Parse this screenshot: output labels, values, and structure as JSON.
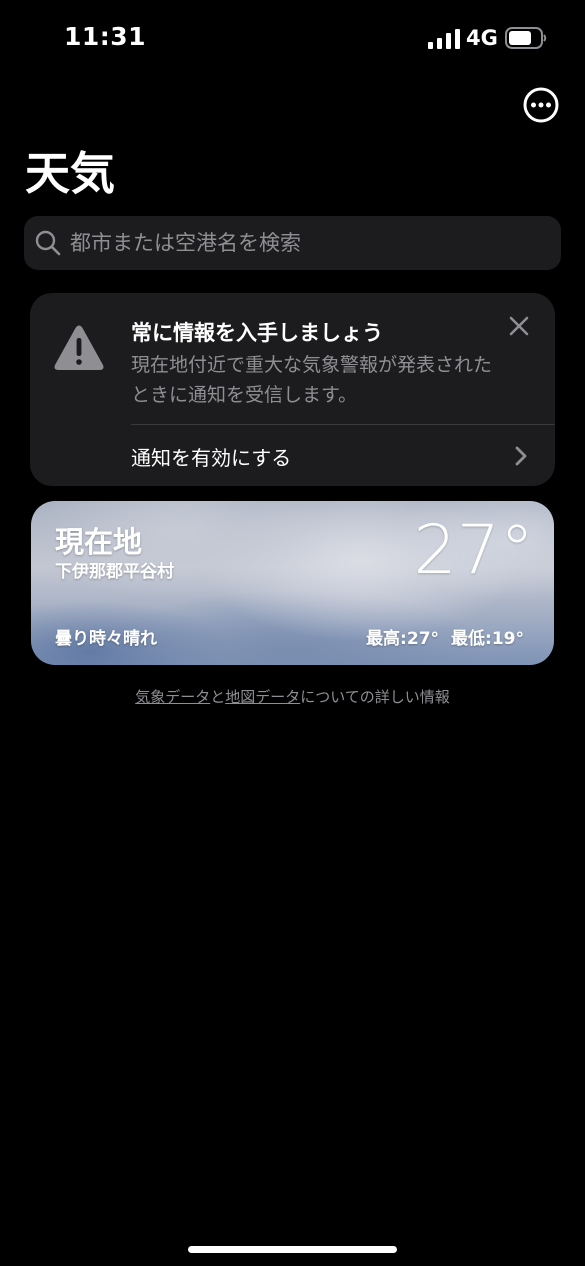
{
  "status_bar": {
    "time": "11:31",
    "network": "4G"
  },
  "header": {
    "title": "天気"
  },
  "search": {
    "placeholder": "都市または空港名を検索"
  },
  "alert": {
    "title": "常に情報を入手しましょう",
    "body": "現在地付近で重大な気象警報が発表されたときに通知を受信します。",
    "action_label": "通知を有効にする"
  },
  "weather_card": {
    "location": "現在地",
    "sublocation": "下伊那郡平谷村",
    "temperature": "27°",
    "condition": "曇り時々晴れ",
    "high": "最高:27°",
    "low": "最低:19°"
  },
  "footer": {
    "weather_data_link": "気象データ",
    "connector": "と",
    "map_data_link": "地図データ",
    "suffix": "についての詳しい情報"
  },
  "icons": {
    "more": "ellipsis-circle-icon",
    "search": "search-icon",
    "warning": "warning-triangle-icon",
    "close": "close-icon",
    "chevron": "chevron-right-icon"
  }
}
